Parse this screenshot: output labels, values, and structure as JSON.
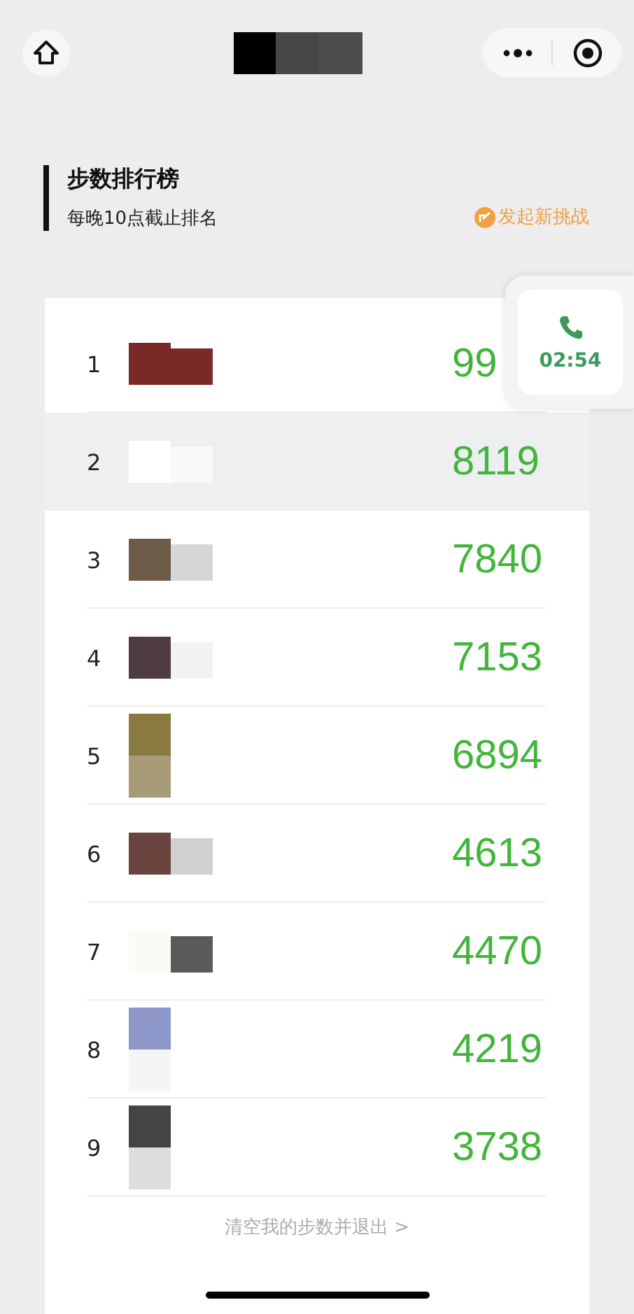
{
  "header": {
    "title": "步数排行榜",
    "subtitle": "每晚10点截止排名",
    "action": "发起新挑战"
  },
  "ranking": [
    {
      "rank": "1",
      "steps": "99",
      "selected": false
    },
    {
      "rank": "2",
      "steps": "8119",
      "selected": true
    },
    {
      "rank": "3",
      "steps": "7840",
      "selected": false
    },
    {
      "rank": "4",
      "steps": "7153",
      "selected": false
    },
    {
      "rank": "5",
      "steps": "6894",
      "selected": false
    },
    {
      "rank": "6",
      "steps": "4613",
      "selected": false
    },
    {
      "rank": "7",
      "steps": "4470",
      "selected": false
    },
    {
      "rank": "8",
      "steps": "4219",
      "selected": false
    },
    {
      "rank": "9",
      "steps": "3738",
      "selected": false
    }
  ],
  "call": {
    "time": "02:54"
  },
  "footer": {
    "link": "清空我的步数并退出 >"
  }
}
